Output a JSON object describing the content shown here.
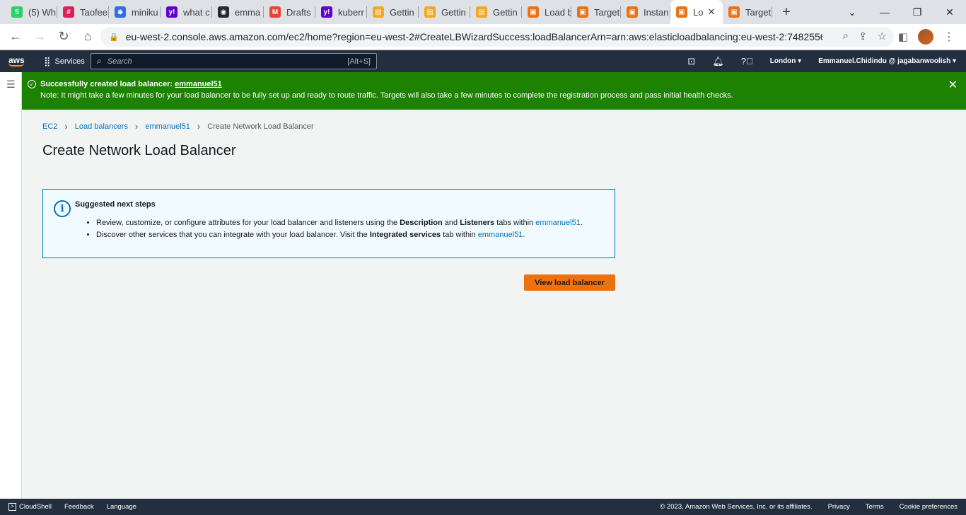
{
  "browser": {
    "tabs": [
      {
        "label": "(5) Wh",
        "favicon": "whatsapp-icon",
        "color": "#25d366",
        "glyph": "5"
      },
      {
        "label": "Taofee",
        "favicon": "slack-icon",
        "color": "#e01e5a",
        "glyph": "#"
      },
      {
        "label": "miniku",
        "favicon": "minikube-icon",
        "color": "#326ce5",
        "glyph": "⎈"
      },
      {
        "label": "what c",
        "favicon": "yahoo-icon",
        "color": "#6001d2",
        "glyph": "y!"
      },
      {
        "label": "emma",
        "favicon": "github-icon",
        "color": "#24292f",
        "glyph": "◉"
      },
      {
        "label": "Drafts",
        "favicon": "gmail-icon",
        "color": "#ea4335",
        "glyph": "M"
      },
      {
        "label": "kuberr",
        "favicon": "yahoo-icon",
        "color": "#6001d2",
        "glyph": "y!"
      },
      {
        "label": "Gettin",
        "favicon": "docs-icon",
        "color": "#f5a623",
        "glyph": "▤"
      },
      {
        "label": "Gettin",
        "favicon": "docs-icon",
        "color": "#f5a623",
        "glyph": "▤"
      },
      {
        "label": "Gettin",
        "favicon": "docs-icon",
        "color": "#f5a623",
        "glyph": "▤"
      },
      {
        "label": "Load b",
        "favicon": "aws-ec2-icon",
        "color": "#ec7211",
        "glyph": "▣"
      },
      {
        "label": "Target",
        "favicon": "aws-ec2-icon",
        "color": "#ec7211",
        "glyph": "▣"
      },
      {
        "label": "Instan",
        "favicon": "aws-ec2-icon",
        "color": "#ec7211",
        "glyph": "▣"
      },
      {
        "label": "Lo",
        "favicon": "aws-ec2-icon",
        "color": "#ec7211",
        "glyph": "▣",
        "active": true
      },
      {
        "label": "Target",
        "favicon": "aws-ec2-icon",
        "color": "#ec7211",
        "glyph": "▣"
      }
    ],
    "url": "eu-west-2.console.aws.amazon.com/ec2/home?region=eu-west-2#CreateLBWizardSuccess:loadBalancerArn=arn:aws:elasticloadbalancing:eu-west-2:7482556..."
  },
  "aws_nav": {
    "logo": "aws",
    "services": "Services",
    "search_placeholder": "Search",
    "search_shortcut": "[Alt+S]",
    "region": "London ▾",
    "account": "Emmanuel.Chidindu @ jagabanwoolish ▾"
  },
  "flash": {
    "title_prefix": "Successfully created load balancer: ",
    "title_link": "emmanuel51",
    "note": "Note: It might take a few minutes for your load balancer to be fully set up and ready to route traffic. Targets will also take a few minutes to complete the registration process and pass initial health checks.",
    "color": "#1d8102"
  },
  "breadcrumb": {
    "items": [
      "EC2",
      "Load balancers",
      "emmanuel51"
    ],
    "current": "Create Network Load Balancer"
  },
  "page_title": "Create Network Load Balancer",
  "info": {
    "title": "Suggested next steps",
    "step1": {
      "a": "Review, customize, or configure attributes for your load balancer and listeners using the ",
      "b": "Description",
      "c": " and ",
      "d": "Listeners",
      "e": " tabs within ",
      "link": "emmanuel51",
      "f": "."
    },
    "step2": {
      "a": "Discover other services that you can integrate with your load balancer. Visit the ",
      "b": "Integrated services",
      "c": " tab within ",
      "link": "emmanuel51",
      "d": "."
    }
  },
  "primary_button": "View load balancer",
  "footer": {
    "cloudshell": "CloudShell",
    "feedback": "Feedback",
    "language": "Language",
    "copyright": "© 2023, Amazon Web Services, Inc. or its affiliates.",
    "privacy": "Privacy",
    "terms": "Terms",
    "cookies": "Cookie preferences"
  }
}
